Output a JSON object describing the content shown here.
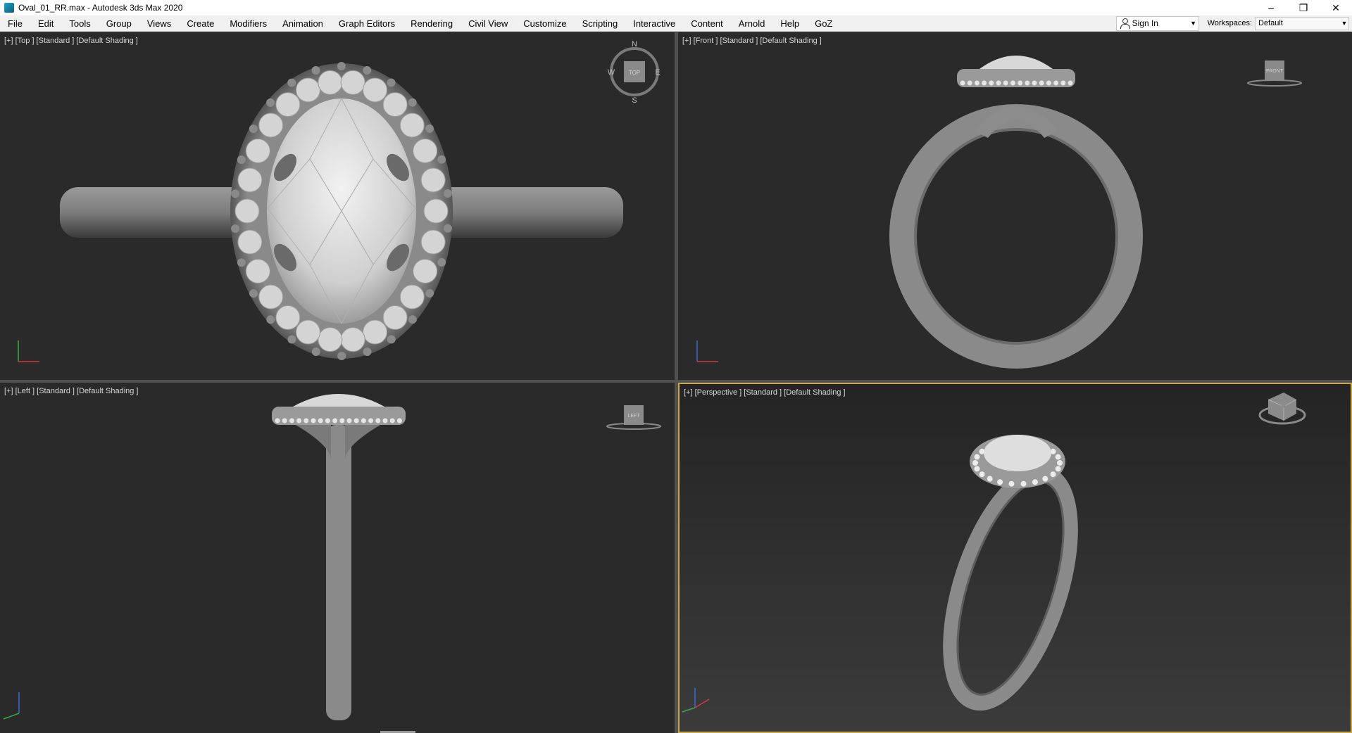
{
  "window": {
    "title": "Oval_01_RR.max - Autodesk 3ds Max 2020",
    "minimize": "–",
    "restore": "❐",
    "close": "✕"
  },
  "menu": [
    "File",
    "Edit",
    "Tools",
    "Group",
    "Views",
    "Create",
    "Modifiers",
    "Animation",
    "Graph Editors",
    "Rendering",
    "Civil View",
    "Customize",
    "Scripting",
    "Interactive",
    "Content",
    "Arnold",
    "Help",
    "GoZ"
  ],
  "account": {
    "signin_label": "Sign In",
    "icon": "user-icon"
  },
  "workspaces": {
    "label": "Workspaces:",
    "value": "Default"
  },
  "viewports": {
    "top": {
      "label": "[+] [Top ] [Standard ] [Default Shading ]",
      "compass": {
        "n": "N",
        "s": "S",
        "e": "E",
        "w": "W",
        "cube": "TOP"
      }
    },
    "front": {
      "label": "[+] [Front ] [Standard ] [Default Shading ]",
      "cube": "FRONT"
    },
    "left": {
      "label": "[+] [Left ] [Standard ] [Default Shading ]",
      "cube": "LEFT"
    },
    "perspective": {
      "label": "[+] [Perspective ] [Standard ] [Default Shading ]"
    }
  },
  "colors": {
    "viewport_bg": "#2a2a2a",
    "active_border": "#c8a84b",
    "axis_x": "#d23a3a",
    "axis_y": "#3aa84a",
    "axis_z": "#3a6ad2"
  }
}
